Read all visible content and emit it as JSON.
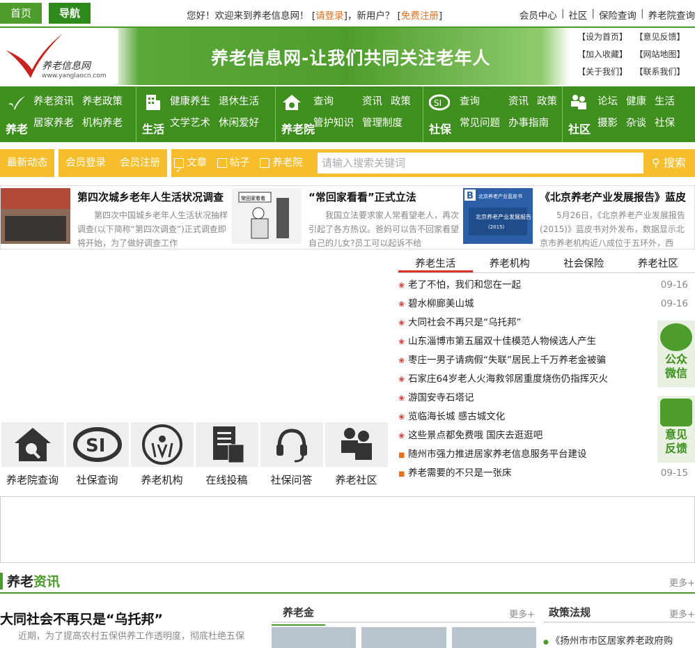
{
  "topbar": {
    "home": "首页",
    "nav": "导航",
    "welcome_prefix": "您好！欢迎来到养老信息网！ [",
    "login": "请登录",
    "welcome_mid": "]，新用户？ [",
    "register": "免费注册",
    "welcome_suffix": "]",
    "links": [
      "会员中心",
      "社区",
      "保险查询",
      "养老院查询"
    ]
  },
  "header": {
    "brand": "养老信息网",
    "url": "www.yanglaocn.com",
    "slogan": "养老信息网-让我们共同关注老年人",
    "quick_links": [
      "【设为首页】",
      "【意见反馈】",
      "【加入收藏】",
      "【网站地图】",
      "【关于我们】",
      "【联系我们】"
    ]
  },
  "gnav": [
    {
      "title": "养老",
      "links": [
        "养老资讯",
        "养老政策",
        "居家养老",
        "机构养老"
      ]
    },
    {
      "title": "生活",
      "links": [
        "健康养生",
        "退休生活",
        "文学艺术",
        "休闲爱好"
      ]
    },
    {
      "title": "养老院",
      "links": [
        "查询",
        "资讯",
        "政策",
        "管护知识",
        "管理制度"
      ]
    },
    {
      "title": "社保",
      "links": [
        "查询",
        "资讯",
        "政策",
        "常见问题",
        "办事指南"
      ]
    },
    {
      "title": "社区",
      "links": [
        "论坛",
        "健康",
        "生活",
        "摄影",
        "杂谈",
        "社保"
      ]
    }
  ],
  "searchbar": {
    "latest": "最新动态",
    "member_login": "会员登录",
    "member_register": "会员注册",
    "options": [
      {
        "label": "文章",
        "checked": true
      },
      {
        "label": "帖子",
        "checked": false
      },
      {
        "label": "养老院",
        "checked": false
      }
    ],
    "placeholder": "请输入搜索关键词",
    "button": "搜索"
  },
  "features": [
    {
      "title": "第四次城乡老年人生活状况调查",
      "desc": "第四次中国城乡老年人生活状况抽样调查(以下简称“第四次调查”)正式调查即将开始，为了做好调查工作"
    },
    {
      "title": "“常回家看看”正式立法",
      "desc": "我国立法要求家人常看望老人，再次引起了各方热议。爸妈可以告不回家看望自己的儿女?员工可以起诉不给",
      "img_caption": "常回家看看"
    },
    {
      "title": "《北京养老产业发展报告》蓝皮",
      "desc": "5月26日，《北京养老产业发展报告(2015)》蓝皮书对外发布，数据显示北京市养老机构近八成位于五环外，西",
      "img_caption": "北京养老产业发展报告",
      "img_top": "北京养老产业蓝皮书",
      "img_year": "(2015)"
    }
  ],
  "services": [
    "养老院查询",
    "社保查询",
    "养老机构",
    "在线投稿",
    "社保问答",
    "养老社区"
  ],
  "tabs": [
    "养老生活",
    "养老机构",
    "社会保险",
    "养老社区"
  ],
  "news": [
    {
      "title": "老了不怕，我们和您在一起",
      "date": "09-16"
    },
    {
      "title": "碧水柳廊美山城",
      "date": "09-16"
    },
    {
      "title": "大同社会不再只是“乌托邦”",
      "date": ""
    },
    {
      "title": "山东淄博市第五届双十佳模范人物候选人产生",
      "date": ""
    },
    {
      "title": "枣庄一男子请病假“失联”居民上千万养老金被骗",
      "date": ""
    },
    {
      "title": "石家庄64岁老人火海救邻居重度烧伤仍指挥灭火",
      "date": ""
    },
    {
      "title": "游国安寺石塔记",
      "date": ""
    },
    {
      "title": "览临海长城 感古城文化",
      "date": ""
    },
    {
      "title": "这些景点都免费哦 国庆去逛逛吧",
      "date": ""
    },
    {
      "title": "随州市强力推进居家养老信息服务平台建设",
      "date": ""
    },
    {
      "title": "养老需要的不只是一张床",
      "date": "09-15"
    }
  ],
  "float": {
    "wechat": "公众微信",
    "feedback": "意见反馈"
  },
  "section": {
    "title_a": "养老",
    "title_b": "资讯",
    "more": "更多+",
    "headline": "大同社会不再只是“乌托邦”",
    "headline_desc": "近期，为了提高农村五保供养工作透明度，彻底杜绝五保",
    "col2_title": "养老金",
    "col3_title": "政策法规",
    "col3_item": "《扬州市市区居家养老政府购"
  }
}
